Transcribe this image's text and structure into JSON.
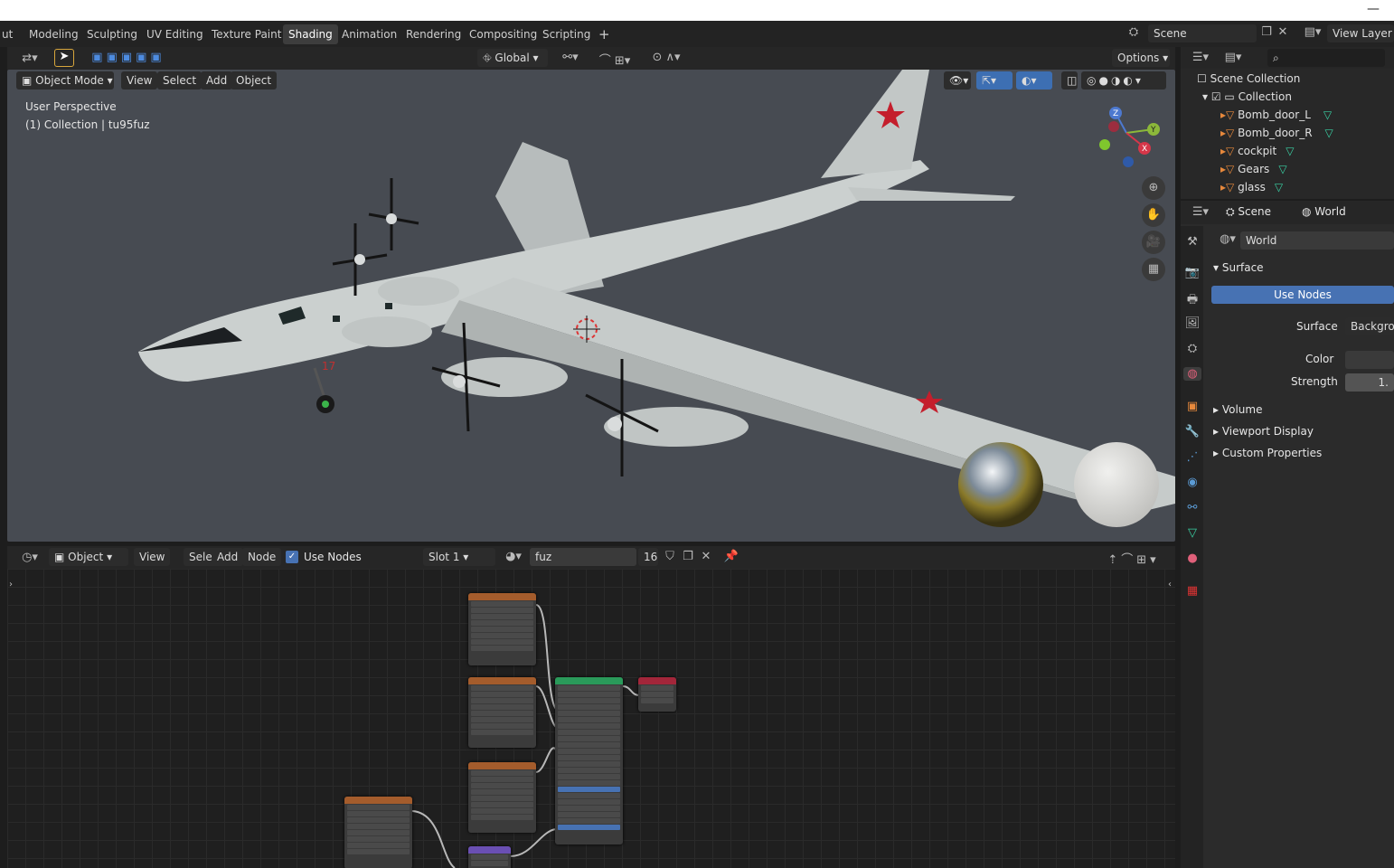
{
  "workspace_tabs": [
    "ut",
    "Modeling",
    "Sculpting",
    "UV Editing",
    "Texture Paint",
    "Shading",
    "Animation",
    "Rendering",
    "Compositing",
    "Scripting",
    "+"
  ],
  "active_tab": "Shading",
  "scene": {
    "name": "Scene",
    "view_layer": "View Layer"
  },
  "viewport": {
    "mode": "Object Mode",
    "menus": [
      "View",
      "Select",
      "Add",
      "Object"
    ],
    "transform": "Global",
    "options": "Options",
    "info_line1": "User Perspective",
    "info_line2": "(1) Collection | tu95fuz",
    "aircraft_number": "17",
    "gizmo": {
      "x": "X",
      "y": "Y",
      "z": "Z"
    }
  },
  "node_editor": {
    "mode": "Object",
    "menus": [
      "View",
      "Select",
      "Add",
      "Node"
    ],
    "use_nodes_label": "Use Nodes",
    "slot": "Slot 1",
    "material": "fuz",
    "users": "16"
  },
  "outliner": {
    "search_placeholder": "",
    "scene_collection": "Scene Collection",
    "collection": "Collection",
    "items": [
      "Bomb_door_L",
      "Bomb_door_R",
      "cockpit",
      "Gears",
      "glass"
    ]
  },
  "properties": {
    "breadcrumb_scene": "Scene",
    "breadcrumb_world": "World",
    "world_name": "World",
    "surface_panel": "Surface",
    "use_nodes": "Use Nodes",
    "surface_label": "Surface",
    "surface_value": "Backgrou",
    "color_label": "Color",
    "strength_label": "Strength",
    "strength_value": "1.",
    "panels": [
      "Volume",
      "Viewport Display",
      "Custom Properties"
    ]
  },
  "colors": {
    "accent": "#4772b3",
    "object_icon": "#e8893c",
    "mesh_icon": "#3ad1a4"
  }
}
